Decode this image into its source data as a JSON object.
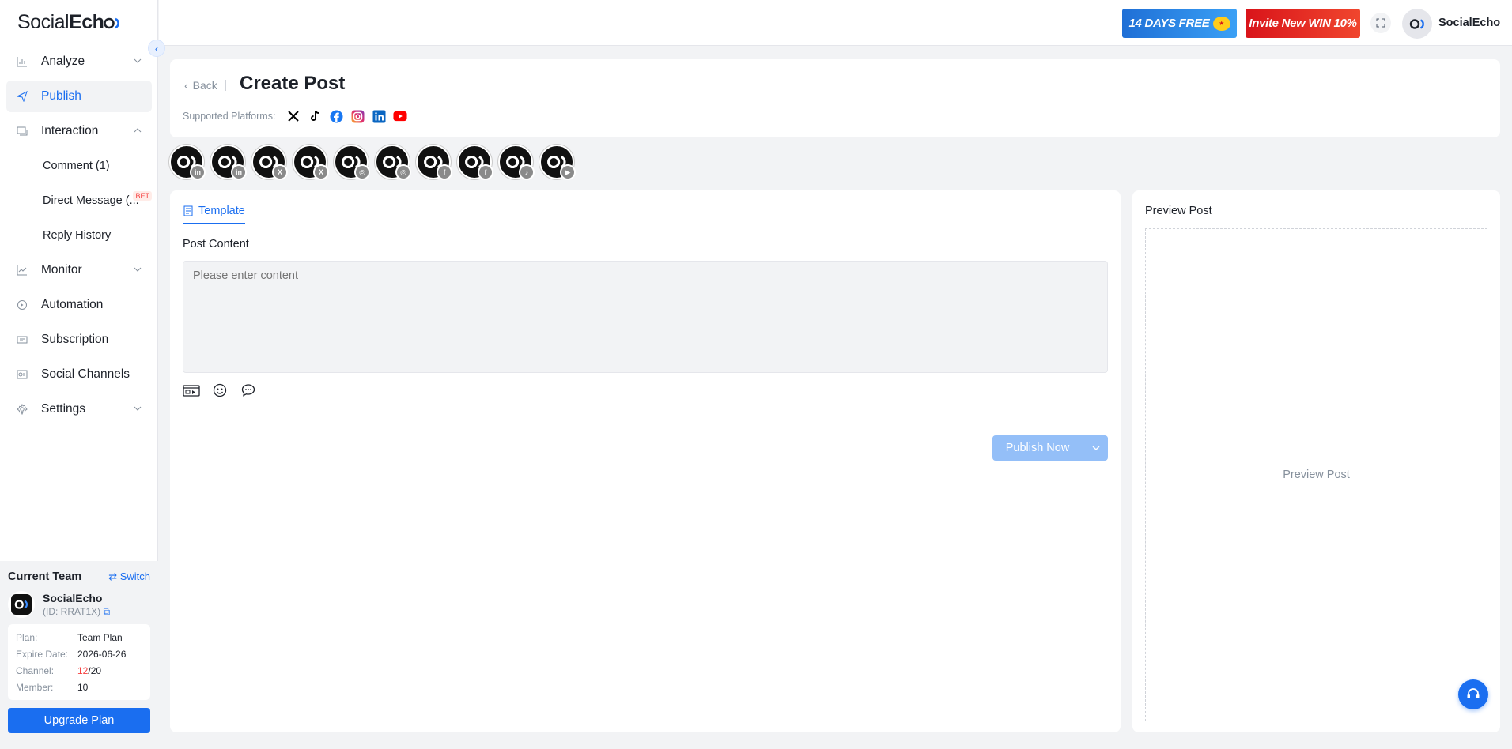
{
  "app": {
    "logo_text_light": "Social",
    "logo_text_bold": "Ech"
  },
  "sidebar": {
    "items": [
      {
        "label": "Analyze",
        "icon": "chart-icon",
        "chevron": "down"
      },
      {
        "label": "Publish",
        "icon": "send-icon",
        "active": true
      },
      {
        "label": "Interaction",
        "icon": "interaction-icon",
        "chevron": "up"
      },
      {
        "label": "Monitor",
        "icon": "monitor-icon",
        "chevron": "down"
      },
      {
        "label": "Automation",
        "icon": "automation-icon"
      },
      {
        "label": "Subscription",
        "icon": "ticket-icon"
      },
      {
        "label": "Social Channels",
        "icon": "channels-icon"
      },
      {
        "label": "Settings",
        "icon": "gear-icon",
        "chevron": "down"
      }
    ],
    "sub_items": [
      {
        "label": "Comment (1)"
      },
      {
        "label": "Direct Message (...",
        "badge": "BET"
      },
      {
        "label": "Reply History"
      }
    ]
  },
  "team": {
    "title": "Current Team",
    "switch_label": "Switch",
    "name": "SocialEcho",
    "id_text": "(ID: RRAT1X)",
    "plan": [
      {
        "key": "Plan:",
        "value": "Team Plan"
      },
      {
        "key": "Expire Date:",
        "value": "2026-06-26"
      },
      {
        "key": "Channel:",
        "value_used": "12",
        "value_total": "/20"
      },
      {
        "key": "Member:",
        "value": "10"
      }
    ],
    "upgrade_label": "Upgrade Plan"
  },
  "header": {
    "promo1": "14 DAYS FREE",
    "promo2": "Invite New WIN 10%",
    "user_name": "SocialEcho"
  },
  "page": {
    "back_label": "Back",
    "title": "Create Post",
    "supported_label": "Supported Platforms:",
    "platforms": [
      "x-icon",
      "tiktok-icon",
      "facebook-icon",
      "instagram-icon",
      "linkedin-icon",
      "youtube-icon"
    ]
  },
  "accounts": [
    {
      "platform": "linkedin",
      "badge": "in"
    },
    {
      "platform": "linkedin",
      "badge": "in"
    },
    {
      "platform": "x",
      "badge": "X"
    },
    {
      "platform": "x",
      "badge": "X"
    },
    {
      "platform": "instagram",
      "badge": "◎"
    },
    {
      "platform": "instagram",
      "badge": "◎"
    },
    {
      "platform": "facebook",
      "badge": "f"
    },
    {
      "platform": "facebook",
      "badge": "f"
    },
    {
      "platform": "tiktok",
      "badge": "♪"
    },
    {
      "platform": "youtube",
      "badge": "▶"
    }
  ],
  "editor": {
    "tab_label": "Template",
    "content_label": "Post Content",
    "content_placeholder": "Please enter content",
    "content_value": "",
    "publish_label": "Publish Now"
  },
  "preview": {
    "title": "Preview Post",
    "placeholder": "Preview Post"
  },
  "colors": {
    "accent": "#1a6ef0",
    "disabled_accent": "#94bff8",
    "danger": "#f53f3f"
  }
}
